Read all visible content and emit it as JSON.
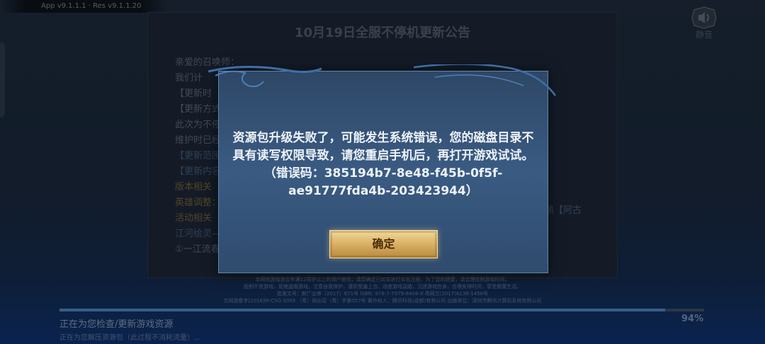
{
  "version_text": "App v9.1.1.1 · Res v9.1.1.20",
  "mute": {
    "icon": "speaker-icon",
    "label": "静音"
  },
  "notice": {
    "title": "10月19日全服不停机更新公告",
    "lines": [
      {
        "text": "亲爱的召唤师：",
        "style": "normal"
      },
      {
        "text": "我们计",
        "style": "normal"
      },
      {
        "text": "【更新时",
        "style": "normal"
      },
      {
        "text": "【更新方式",
        "style": "normal"
      },
      {
        "text": "此次为不停",
        "style": "normal"
      },
      {
        "text": "维护时已经",
        "style": "normal"
      },
      {
        "text": "【更新范围",
        "style": "dimblue"
      },
      {
        "text": "【更新内容",
        "style": "dimblue"
      },
      {
        "text": "版本相关",
        "style": "orange"
      },
      {
        "text": "英雄调整：",
        "style": "orange"
      },
      {
        "text": "活动相关",
        "style": "orange"
      },
      {
        "text": "江河绘灵——",
        "style": "dimblue"
      },
      {
        "text": "①一江流春",
        "style": "normal"
      }
    ],
    "right_fragment": "锁【阿古"
  },
  "legal": {
    "lines": [
      "本网络游戏适合年满12周岁以上的用户使用；请您确定已如实进行实名注册，为了您的健康，请合理控制游戏时间。",
      "抵制不良游戏，拒绝盗版游戏，注意自我保护，谨防受骗上当。适度游戏益脑，沉迷游戏伤身，合理安排时间，享受健康生活。",
      "批准文号：新广出审〔2017〕671号  ISBN: 978-7-7979-8408-9  粤网文(2017)6138-1456号",
      "文网游备字[2016]M-CSG 0059  （粤）网出证（粤）字第057号  著作权人：腾讯科技(成都)有限公司  出版单位：深圳市腾讯计算机系统有限公司"
    ]
  },
  "progress": {
    "value": 0.94,
    "percent_text": "94%",
    "status_main": "正在为您检查/更新游戏资源",
    "status_sub": "正在为您解压资源包（此过程不消耗流量）..."
  },
  "dialog": {
    "message": "资源包升级失败了，可能发生系统错误，您的磁盘目录不具有读写权限导致，请您重启手机后，再打开游戏试试。（错误码：385194b7-8e48-f45b-0f5f-ae91777fda4b-203423944）",
    "confirm_label": "确定"
  },
  "colors": {
    "accent_gold": "#d9b064",
    "dialog_border": "#5f86b0",
    "progress_fill": "#4e7fb6"
  }
}
